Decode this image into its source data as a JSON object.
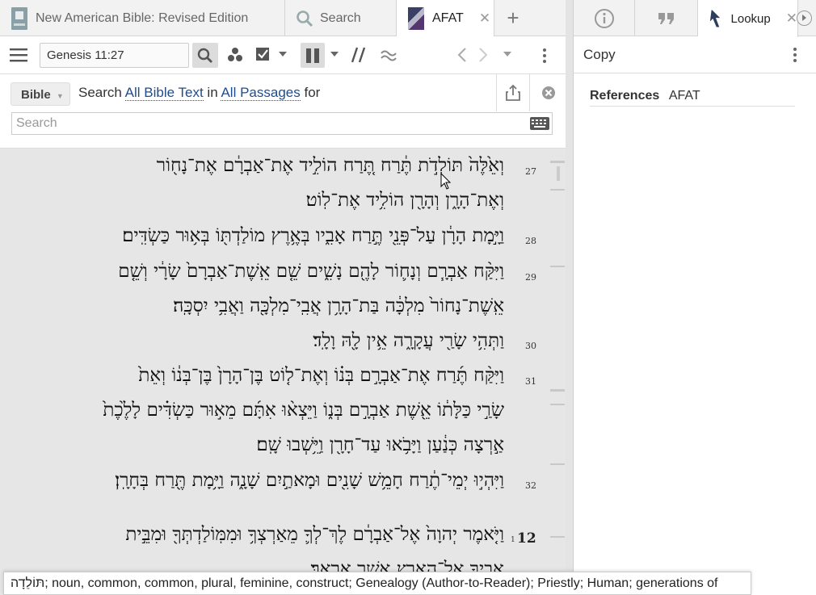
{
  "tabs": [
    {
      "label": "New American Bible: Revised Edition",
      "icon": "bible-book-icon"
    },
    {
      "label": "Search",
      "icon": "search-icon"
    },
    {
      "label": "AFAT",
      "icon": "afat-book-icon",
      "close": "✕"
    }
  ],
  "new_tab_label": "+",
  "toolbar": {
    "reference": "Genesis 11:27"
  },
  "search": {
    "scope_button": "Bible",
    "line_prefix": "Search",
    "text_scope": "All Bible Text",
    "in_word": "in",
    "passage_scope": "All Passages",
    "for_word": "for",
    "placeholder": "Search"
  },
  "verses": [
    {
      "num": "27",
      "lines": [
        "וְאֵ֙לֶּה֙ תּוֹלְדֹ֣ת תֶּ֔רַח תֶּ֚רַח הוֹלִ֣יד אֶת־אַבְרָ֔ם אֶת־נָח֖וֹר",
        "וְאֶת־הָרָ֑ן וְהָרָ֖ן הוֹלִ֥יד אֶת־לֽוֹט׃"
      ]
    },
    {
      "num": "28",
      "lines": [
        "וַיָּ֣מָת הָרָ֔ן עַל־פְּנֵ֖י תֶּ֣רַח אָבִ֑יו בְּאֶ֥רֶץ מוֹלַדְתּ֖וֹ בְּא֥וּר כַּשְׂדִּֽים׃"
      ]
    },
    {
      "num": "29",
      "lines": [
        "וַיִּקַּ֨ח אַבְרָ֧ם וְנָח֛וֹר לָהֶ֖ם נָשִׁ֑ים שֵׁ֤ם אֵֽשֶׁת־אַבְרָם֙ שָׂרָ֔י וְשֵׁ֤ם",
        "אֵֽשֶׁת־נָחוֹר֙ מִלְכָּ֔ה בַּת־הָרָ֥ן אֲבִֽי־מִלְכָּ֖ה וַאֲבִ֥י יִסְכָּֽה׃"
      ]
    },
    {
      "num": "30",
      "lines": [
        "וַתְּהִ֥י שָׂרַ֖י עֲקָרָ֑ה אֵ֥ין לָ֖הּ וָלָֽד׃"
      ]
    },
    {
      "num": "31",
      "lines": [
        "וַיִּקַּ֨ח תֶּ֜רַח אֶת־אַבְרָ֣ם בְּנ֗וֹ וְאֶת־ל֤וֹט בֶּן־הָרָן֙ בֶּן־בְּנ֔וֹ וְאֵת֙",
        "שָׂרַ֣י כַּלָּת֔וֹ אֵ֖שֶׁת אַבְרָ֣ם בְּנ֑וֹ וַיֵּצְא֨וּ אִתָּ֜ם מֵא֣וּר כַּשְׂדִּ֗ים לָלֶ֙כֶת֙",
        "אַ֣רְצָה כְּנַ֔עַן וַיָּבֹ֥אוּ עַד־חָרָ֖ן וַיֵּ֥שְׁבוּ שָֽׁם׃"
      ]
    },
    {
      "num": "32",
      "lines": [
        "וַיִּהְי֣וּ יְמֵי־תֶ֔רַח חָמֵ֥שׁ שָׁנִ֖ים וּמָאתַ֣יִם שָׁנָ֑ה וַיָּ֥מָת תֶּ֖רַח בְּחָרָֽן׃"
      ]
    },
    {
      "num": "1",
      "chapter": "12",
      "lines": [
        "וַיֹּ֤אמֶר יְהוָה֙ אֶל־אַבְרָ֔ם לֶךְ־לְךָ֛ מֵאַרְצְךָ֥ וּמִמּֽוֹלַדְתְּךָ֖ וּמִבֵּ֣ית",
        "אָבִ֑יךָ אֶל־הָאָ֖רֶץ אֲשֶׁ֥ר אַרְאֶֽךָּ׃"
      ]
    }
  ],
  "tooltip": "תּוֹלֵדָה; noun, common, common, plural, feminine, construct; Genealogy (Author-to-Reader); Priestly; Human; generations of",
  "right_panel": {
    "tabs": [
      {
        "icon": "info-icon"
      },
      {
        "icon": "quote-icon"
      },
      {
        "label": "Lookup",
        "icon": "lookup-icon",
        "close": "✕"
      }
    ],
    "copy_label": "Copy",
    "references_label": "References",
    "references_value": "AFAT"
  },
  "colors": {
    "link": "#1f4d8c",
    "text_bg": "#e6e6e6"
  }
}
